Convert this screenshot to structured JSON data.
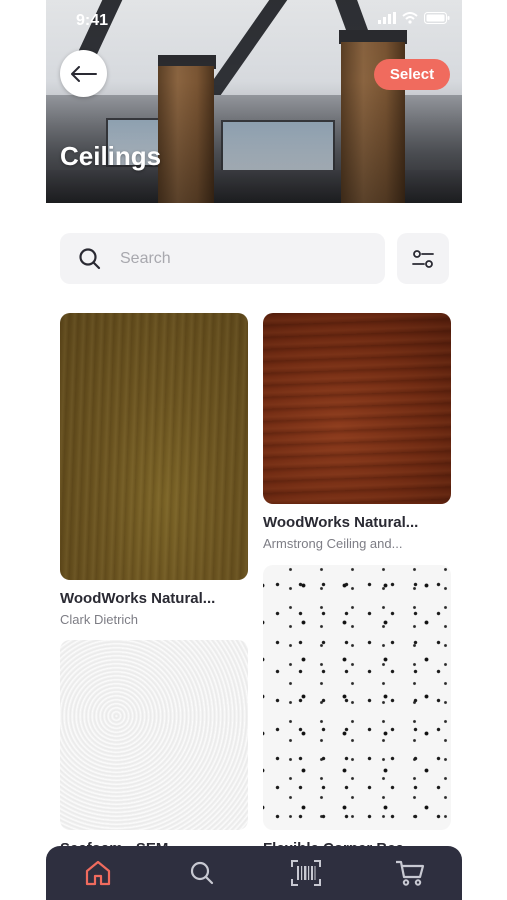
{
  "status_bar": {
    "time": "9:41"
  },
  "header": {
    "title": "Ceilings",
    "select_label": "Select"
  },
  "search": {
    "placeholder": "Search"
  },
  "products": [
    {
      "title": "WoodWorks Natural...",
      "subtitle": "Clark Dietrich",
      "texture": "light-walnut"
    },
    {
      "title": "WoodWorks Natural...",
      "subtitle": "Armstrong Ceiling and...",
      "texture": "cherry"
    },
    {
      "title": "Seafoam - SEM",
      "subtitle": "",
      "texture": "white-stucco"
    },
    {
      "title": "Flexible Corner Bea...",
      "subtitle": "",
      "texture": "speckled-tile"
    }
  ],
  "nav": {
    "items": [
      {
        "name": "home",
        "icon": "home-icon",
        "active": true
      },
      {
        "name": "search",
        "icon": "search-icon",
        "active": false
      },
      {
        "name": "scan",
        "icon": "barcode-scan-icon",
        "active": false
      },
      {
        "name": "cart",
        "icon": "cart-icon",
        "active": false
      }
    ]
  },
  "colors": {
    "accent": "#f06b5e",
    "nav_bg": "#2e2f3f",
    "text_dark": "#2a2a33",
    "text_muted": "#7d7d85",
    "field_bg": "#f3f3f5"
  }
}
